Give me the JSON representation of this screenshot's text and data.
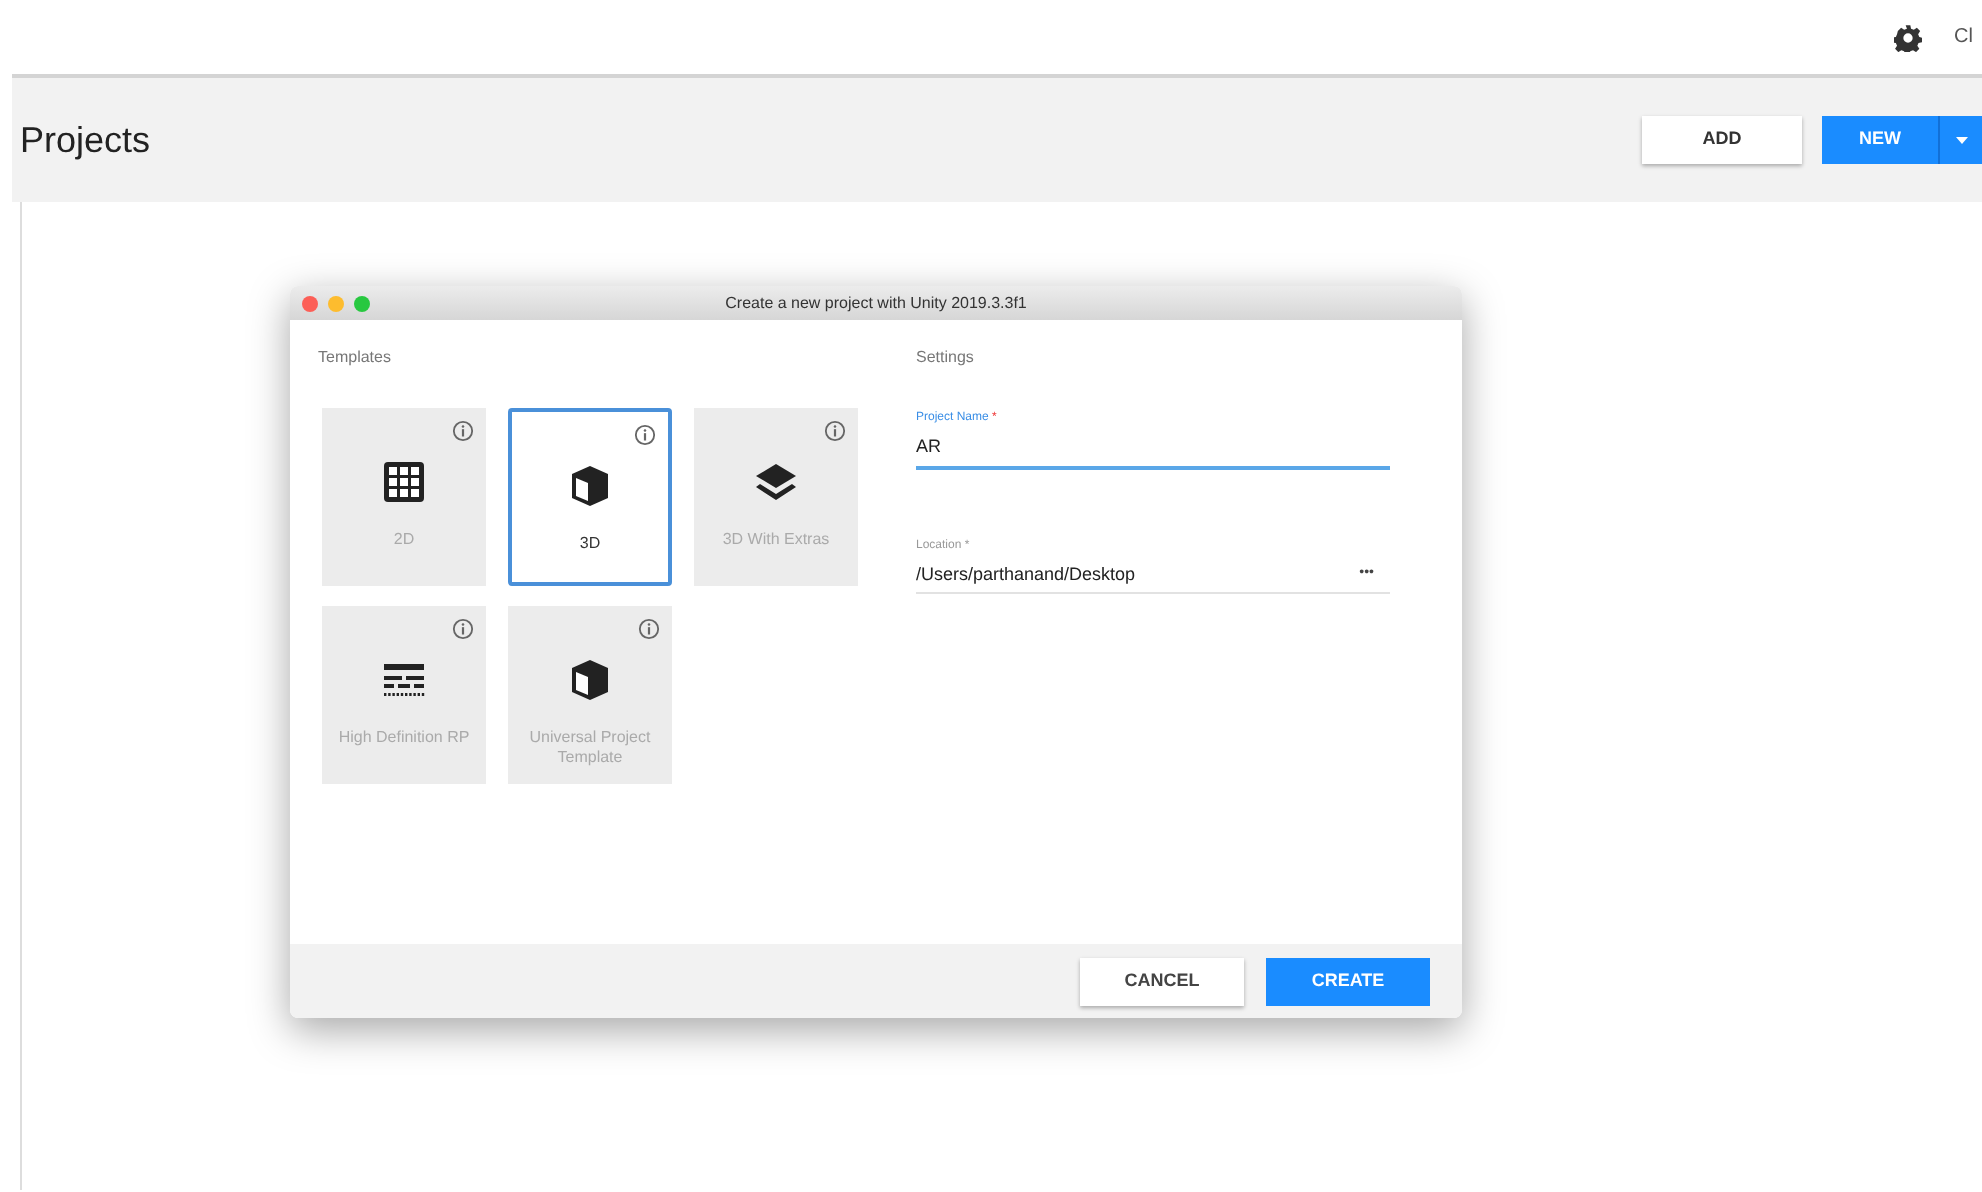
{
  "top_bar": {
    "account_label": "Cl"
  },
  "header": {
    "title": "Projects",
    "add_button": "ADD",
    "new_button": "NEW"
  },
  "dialog": {
    "title": "Create a new project with Unity 2019.3.3f1",
    "templates_heading": "Templates",
    "templates": [
      {
        "label": "2D",
        "kind": "grid",
        "selected": false
      },
      {
        "label": "3D",
        "kind": "cube",
        "selected": true
      },
      {
        "label": "3D With Extras",
        "kind": "layers",
        "selected": false
      },
      {
        "label": "High Definition RP",
        "kind": "hdrp",
        "selected": false
      },
      {
        "label": "Universal Project Template",
        "kind": "cube",
        "selected": false
      }
    ],
    "settings_heading": "Settings",
    "project_name": {
      "label": "Project Name",
      "required_mark": "*",
      "value": "AR"
    },
    "location": {
      "label": "Location",
      "required_mark": "*",
      "value": "/Users/parthanand/Desktop",
      "browse": "•••"
    },
    "cancel_button": "CANCEL",
    "create_button": "CREATE"
  }
}
